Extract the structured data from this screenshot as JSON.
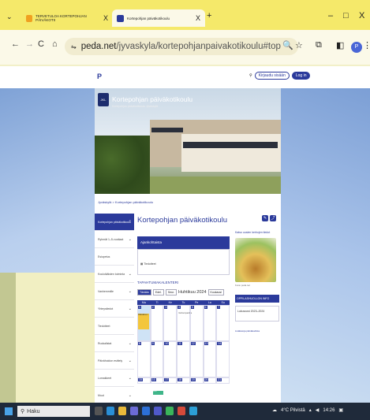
{
  "browser": {
    "tabs": [
      {
        "label": "TERVETULOA KORTEPOHJAN PÄIVÄKOTII",
        "close": "X"
      },
      {
        "label": "Kortepohjan päiväkotikoulu",
        "close": "X"
      }
    ],
    "new_tab": "+",
    "window": {
      "minimize": "–",
      "maximize": "□",
      "close": "X"
    },
    "address": {
      "domain": "peda.net",
      "path": "/jyvaskyla/kortepohjanpaivakotikoulu#top"
    },
    "profile_initial": "P"
  },
  "site": {
    "logo": "P",
    "search_label": "Etsi",
    "login_button": "Kirjaudu sisään",
    "lang_button": "Log in"
  },
  "hero": {
    "title": "Kortepohjan päiväkotikoulu",
    "subtitle": "Kortepohjan päiväkotikoulu Jyväskylä",
    "logo_text": "JKL"
  },
  "breadcrumb": "Jyväskylä > Kortepohjan päiväkotikoulu",
  "sidebar": [
    {
      "label": "Kortepohjan päiväkotikoulu",
      "active": true
    },
    {
      "label": "Ryhmät 1–5-vuotiaat",
      "active": false
    },
    {
      "label": "Esiopetus",
      "active": false
    },
    {
      "label": "Kouluikäisten toiminta",
      "active": false
    },
    {
      "label": "Vanhemmille",
      "active": false
    },
    {
      "label": "Yhteystiedot",
      "active": false
    },
    {
      "label": "Tiedotteet",
      "active": false
    },
    {
      "label": "Ruokalistat",
      "active": false
    },
    {
      "label": "Päivähoidon esittely",
      "active": false
    },
    {
      "label": "Lomakkeet",
      "active": false
    },
    {
      "label": "Muut",
      "active": false
    }
  ],
  "main": {
    "title": "Kortepohjan päiväkotikoulu",
    "announcements_head": "Ajankohtaista",
    "announcement_item": "Tiedotteet",
    "calendar_title": "TAPAHTUMAKALENTERI",
    "calendar_today": "Tänään",
    "calendar_prev": "Edel.",
    "calendar_next": "Seur.",
    "calendar_month": "Huhtikuu 2024",
    "calendar_view": "Kuukausi",
    "days": [
      "Ma",
      "Ti",
      "Ke",
      "To",
      "Pe",
      "La",
      "Su"
    ],
    "rows": [
      [
        "1",
        "2",
        "3",
        "4",
        "5",
        "6",
        "7"
      ],
      [
        "8",
        "9",
        "10",
        "11",
        "12",
        "13",
        "14"
      ],
      [
        "15",
        "16",
        "17",
        "18",
        "19",
        "20",
        "21"
      ]
    ],
    "events": [
      "Pääsiäinen",
      "Vanhempainilta",
      "Retki"
    ]
  },
  "right_col": {
    "link": "Katso uusien kerhojen tiedot",
    "img_note": "Kuva: peda.net",
    "head": "OPPILASHUOLLON INFO",
    "box": "Lukuvuosi 2023–2024",
    "small": "Lisätietoja päiväkodista"
  },
  "taskbar": {
    "search": "Haku",
    "weather": "4°C Pilvistä",
    "time": "14:26"
  }
}
